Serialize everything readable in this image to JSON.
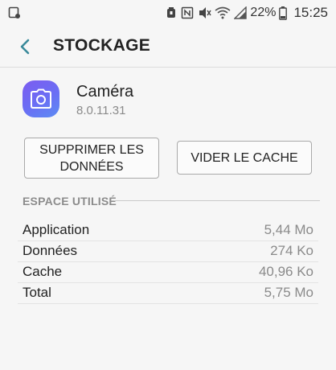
{
  "status_bar": {
    "battery_percent": "22%",
    "time": "15:25"
  },
  "header": {
    "title": "STOCKAGE"
  },
  "app": {
    "name": "Caméra",
    "version": "8.0.11.31"
  },
  "buttons": {
    "clear_data": "SUPPRIMER LES\nDONNÉES",
    "clear_cache": "VIDER LE CACHE"
  },
  "section": {
    "title": "ESPACE UTILISÉ"
  },
  "storage_rows": [
    {
      "label": "Application",
      "value": "5,44 Mo"
    },
    {
      "label": "Données",
      "value": "274 Ko"
    },
    {
      "label": "Cache",
      "value": "40,96 Ko"
    },
    {
      "label": "Total",
      "value": "5,75 Mo"
    }
  ]
}
